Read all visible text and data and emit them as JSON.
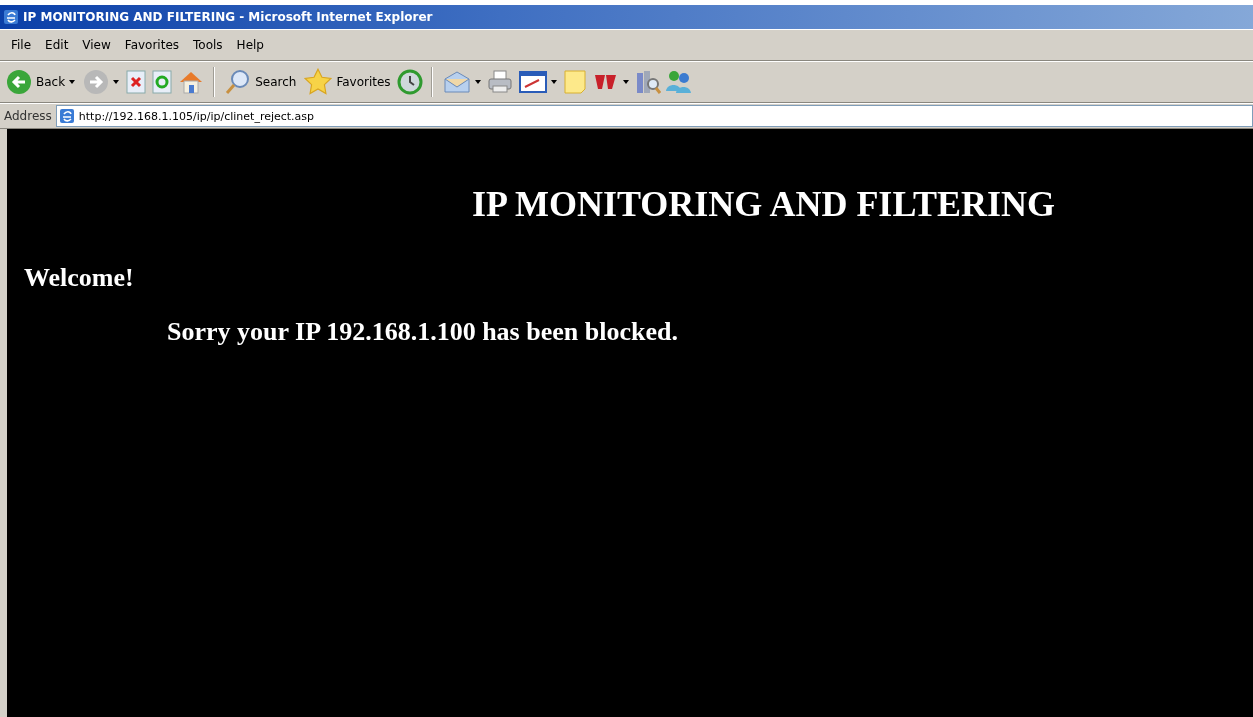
{
  "window": {
    "title": "IP MONITORING AND FILTERING - Microsoft Internet Explorer"
  },
  "menu": [
    "File",
    "Edit",
    "View",
    "Favorites",
    "Tools",
    "Help"
  ],
  "toolbar": {
    "back_label": "Back",
    "search_label": "Search",
    "favorites_label": "Favorites"
  },
  "address": {
    "label": "Address",
    "value": "http://192.168.1.105/ip/ip/clinet_reject.asp"
  },
  "page": {
    "heading": "IP MONITORING AND FILTERING",
    "welcome": "Welcome!",
    "message": "Sorry your IP 192.168.1.100 has been blocked."
  }
}
